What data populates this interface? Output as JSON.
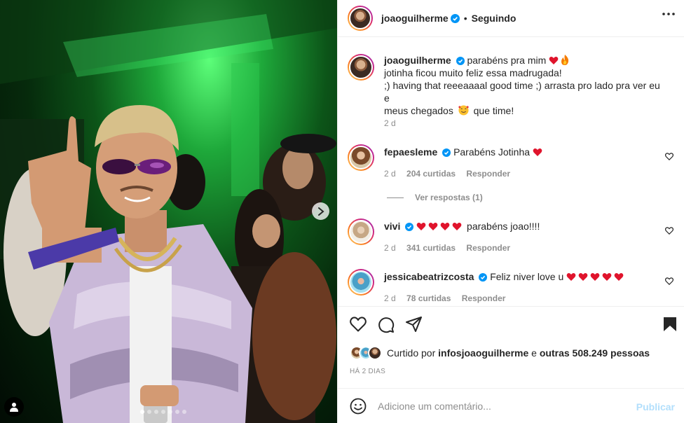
{
  "post": {
    "next_label": "Next",
    "slides_total": 7,
    "slide_active": 1
  },
  "header": {
    "username": "joaoguilherme",
    "separator": "•",
    "follow_status": "Seguindo"
  },
  "caption": {
    "username": "joaoguilherme",
    "line1": "parabéns pra mim",
    "line1_emojis": [
      "red-heart",
      "fire"
    ],
    "line2": "jotinha ficou muito feliz essa madrugada!",
    "line3": ";) having that reeeaaaal good time ;) arrasta pro lado pra ver eu e",
    "line4a": "meus chegados",
    "line4_emoji": "smiling-face-with-hearts",
    "line4b": "que time!",
    "time": "2 d"
  },
  "comments": [
    {
      "username": "fepaesleme",
      "text": "Parabéns Jotinha",
      "emojis": [
        "red-heart"
      ],
      "time": "2 d",
      "likes": "204 curtidas",
      "reply": "Responder"
    },
    {
      "username": "vivi",
      "text": "parabéns joao!!!!",
      "emojis": [
        "red-heart",
        "red-heart",
        "red-heart",
        "red-heart"
      ],
      "time": "2 d",
      "likes": "341 curtidas",
      "reply": "Responder"
    },
    {
      "username": "jessicabeatrizcosta",
      "text": "Feliz niver love u",
      "emojis": [
        "red-heart",
        "red-heart",
        "red-heart",
        "red-heart",
        "red-heart"
      ],
      "time": "2 d",
      "likes": "78 curtidas",
      "reply": "Responder"
    }
  ],
  "view_replies": "Ver respostas (1)",
  "likes": {
    "prefix": "Curtido por",
    "user": "infosjoaoguilherme",
    "middle": "e",
    "others": "outras 508.249 pessoas"
  },
  "date": "HÁ 2 DIAS",
  "add_comment": {
    "placeholder": "Adicione um comentário...",
    "publish": "Publicar"
  },
  "colors": {
    "accent_blue": "#0095f6",
    "publish_disabled": "#b2dffc",
    "heart_red": "#ed4956"
  }
}
